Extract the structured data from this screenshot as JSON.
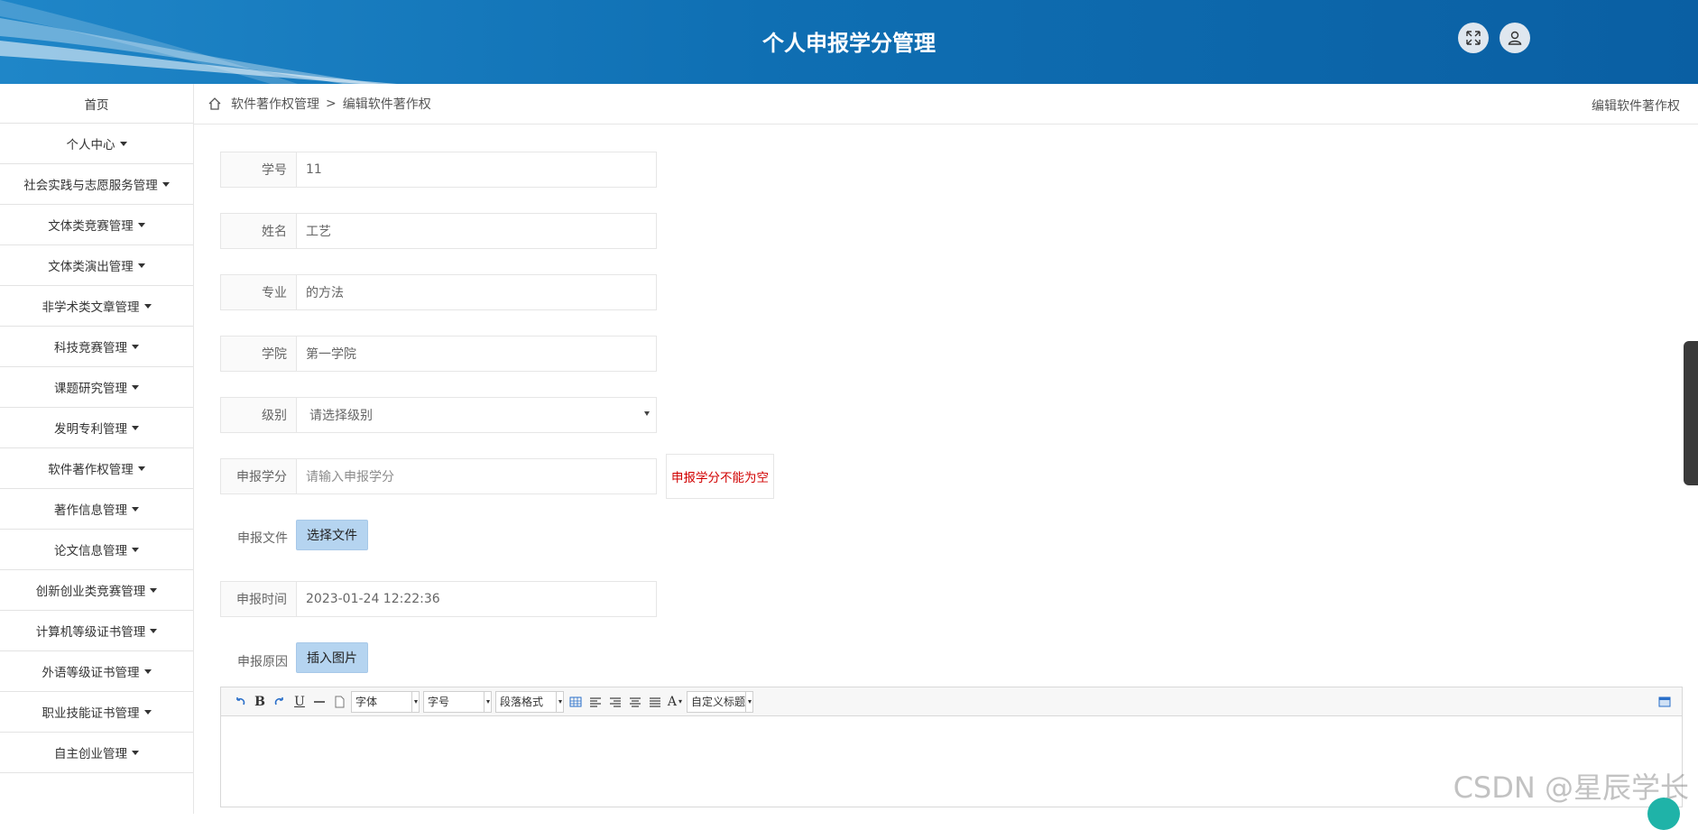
{
  "header": {
    "title": "个人申报学分管理",
    "fullscreen_icon": "expand-arrows-icon",
    "user_icon": "user-icon"
  },
  "sidebar": {
    "items": [
      {
        "label": "首页",
        "has_caret": false
      },
      {
        "label": "个人中心",
        "has_caret": true
      },
      {
        "label": "社会实践与志愿服务管理",
        "has_caret": true
      },
      {
        "label": "文体类竞赛管理",
        "has_caret": true
      },
      {
        "label": "文体类演出管理",
        "has_caret": true
      },
      {
        "label": "非学术类文章管理",
        "has_caret": true
      },
      {
        "label": "科技竞赛管理",
        "has_caret": true
      },
      {
        "label": "课题研究管理",
        "has_caret": true
      },
      {
        "label": "发明专利管理",
        "has_caret": true
      },
      {
        "label": "软件著作权管理",
        "has_caret": true
      },
      {
        "label": "著作信息管理",
        "has_caret": true
      },
      {
        "label": "论文信息管理",
        "has_caret": true
      },
      {
        "label": "创新创业类竞赛管理",
        "has_caret": true
      },
      {
        "label": "计算机等级证书管理",
        "has_caret": true
      },
      {
        "label": "外语等级证书管理",
        "has_caret": true
      },
      {
        "label": "职业技能证书管理",
        "has_caret": true
      },
      {
        "label": "自主创业管理",
        "has_caret": true
      }
    ]
  },
  "breadcrumb": {
    "parent": "软件著作权管理",
    "separator": ">",
    "current": "编辑软件著作权",
    "right_title": "编辑软件著作权"
  },
  "form": {
    "student_id": {
      "label": "学号",
      "value": "11"
    },
    "name": {
      "label": "姓名",
      "value": "工艺"
    },
    "major": {
      "label": "专业",
      "value": "的方法"
    },
    "college": {
      "label": "学院",
      "value": "第一学院"
    },
    "level": {
      "label": "级别",
      "selected": "请选择级别"
    },
    "credit": {
      "label": "申报学分",
      "placeholder": "请输入申报学分",
      "error": "申报学分不能为空"
    },
    "file": {
      "label": "申报文件",
      "button": "选择文件"
    },
    "time": {
      "label": "申报时间",
      "value": "2023-01-24 12:22:36"
    },
    "reason": {
      "label": "申报原因",
      "button": "插入图片"
    }
  },
  "editor": {
    "font_family": "字体",
    "font_size": "字号",
    "paragraph": "段落格式",
    "custom_title": "自定义标题",
    "bold": "B",
    "underline": "U",
    "font_color": "A"
  },
  "watermark": "CSDN @星辰学长",
  "colors": {
    "header_blue": "#0f6fb3",
    "button_blue": "#b5d4f0",
    "error_red": "#d10000"
  }
}
